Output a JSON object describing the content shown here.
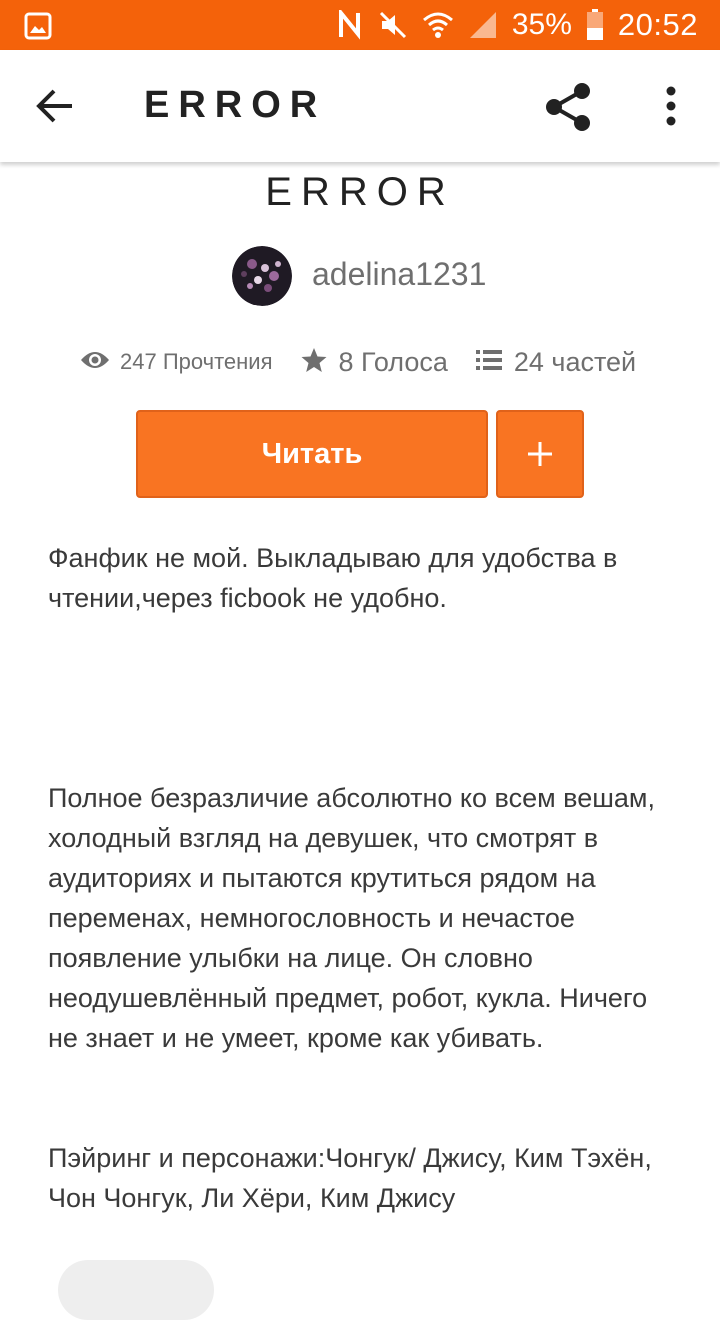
{
  "status_bar": {
    "battery_percent": "35%",
    "time": "20:52",
    "background_color": "#f4620a",
    "icons": [
      "gallery-icon",
      "nfc-icon",
      "mute-icon",
      "wifi-icon",
      "signal-icon",
      "battery-icon"
    ]
  },
  "app_bar": {
    "title": "ERROR",
    "icons": [
      "back-arrow-icon",
      "share-icon",
      "more-vert-icon"
    ]
  },
  "story": {
    "title": "ERROR",
    "author": "adelina1231",
    "stats": {
      "reads": "247 Прочтения",
      "votes": "8 Голоса",
      "parts": "24 частей"
    },
    "read_button_label": "Читать",
    "add_button_symbol": "+",
    "accent_color": "#f97422",
    "description": {
      "paragraph_1": "Фанфик не мой. Выкладываю для удобства в чтении,через ficbook не удобно.",
      "paragraph_2": "Полное безразличие абсолютно ко всем вешам, холодный взгляд на девушек, что смотрят в аудиториях и пытаются крутиться рядом на переменах, немногословность и нечастое появление улыбки на лице. Он словно неодушевлённый предмет, робот, кукла. Ничего не знает и не умеет, кроме как убивать.",
      "paragraph_3": "Пэйринг и персонажи:Чонгук/ Джису, Ким Тэхён, Чон Чонгук, Ли Хёри, Ким Джису"
    }
  }
}
